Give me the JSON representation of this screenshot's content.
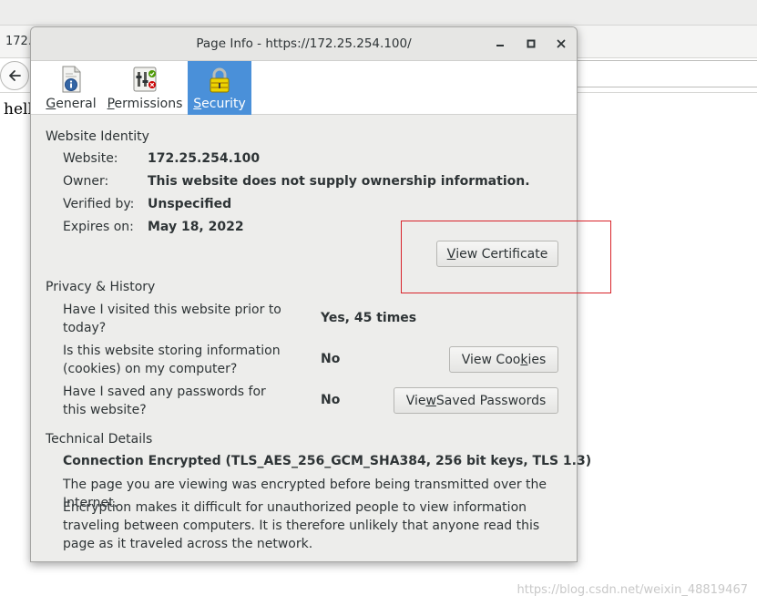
{
  "browser": {
    "tab_title": "172.",
    "page_text": "hell"
  },
  "watermark": "https://blog.csdn.net/weixin_48819467",
  "dialog": {
    "title": "Page Info - https://172.25.254.100/",
    "toolbar": {
      "general": {
        "pre": "",
        "key": "G",
        "post": "eneral"
      },
      "permissions": {
        "pre": "",
        "key": "P",
        "post": "ermissions"
      },
      "security": {
        "pre": "",
        "key": "S",
        "post": "ecurity"
      }
    },
    "identity": {
      "heading": "Website Identity",
      "website_label": "Website:",
      "website_value": "172.25.254.100",
      "owner_label": "Owner:",
      "owner_value": "This website does not supply ownership information.",
      "verified_label": "Verified by:",
      "verified_value": "Unspecified",
      "expires_label": "Expires on:",
      "expires_value": "May 18, 2022",
      "view_cert": {
        "pre": "",
        "key": "V",
        "post": "iew Certificate"
      }
    },
    "privacy": {
      "heading": "Privacy & History",
      "q1": "Have I visited this website prior to today?",
      "a1": "Yes, 45 times",
      "q2": "Is this website storing information (cookies) on my computer?",
      "a2": "No",
      "view_cookies": {
        "pre": "View Coo",
        "key": "k",
        "post": "ies"
      },
      "q3": "Have I saved any passwords for this website?",
      "a3": "No",
      "view_passwords": {
        "pre": "Vie",
        "key": "w",
        "post": " Saved Passwords"
      }
    },
    "technical": {
      "heading": "Technical Details",
      "connection": "Connection Encrypted (TLS_AES_256_GCM_SHA384, 256 bit keys, TLS 1.3)",
      "para1": "The page you are viewing was encrypted before being transmitted over the Internet.",
      "para2": "Encryption makes it difficult for unauthorized people to view information traveling between computers. It is therefore unlikely that anyone read this page as it traveled across the network."
    }
  },
  "colors": {
    "selected_tab": "#4a90d9",
    "annotation": "#d8232a"
  }
}
